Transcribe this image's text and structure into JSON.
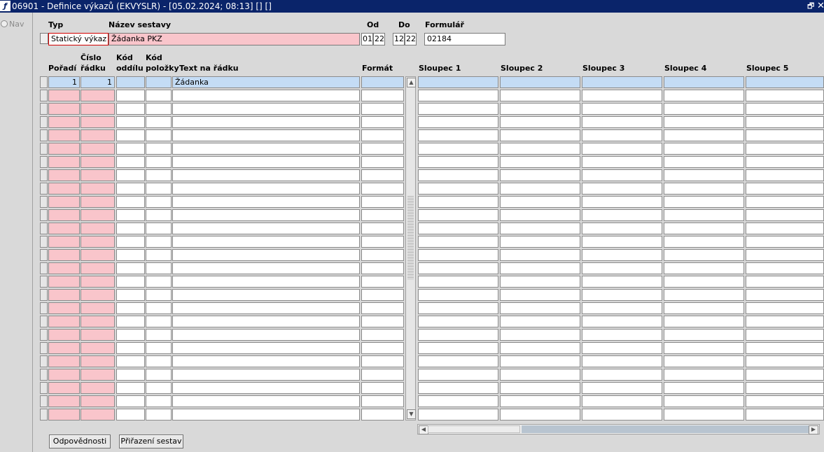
{
  "window": {
    "title": "06901 - Definice výkazů (EKVYSLR) - [05.02.2024; 08:13]  []  []",
    "app_icon": "ƒ"
  },
  "nav": {
    "label": "Nav"
  },
  "header": {
    "typ_label": "Typ",
    "nazev_label": "Název sestavy",
    "od_label": "Od",
    "do_label": "Do",
    "formular_label": "Formulář",
    "typ_value": "Statický výkaz",
    "nazev_value": "Žádanka PKZ",
    "od_month": "01",
    "od_year": "22",
    "do_month": "12",
    "do_year": "22",
    "formular_value": "02184"
  },
  "grid": {
    "col_poradi": "Pořadí",
    "col_cislo_1": "Číslo",
    "col_cislo_2": "řádku",
    "col_kod_oddilu_1": "Kód",
    "col_kod_oddilu_2": "oddílu",
    "col_kod_polozky_1": "Kód",
    "col_kod_polozky_2": "položky",
    "col_text": "Text na řádku",
    "col_format": "Formát",
    "col_sloupec_1": "Sloupec 1",
    "col_sloupec_2": "Sloupec 2",
    "col_sloupec_3": "Sloupec 3",
    "col_sloupec_4": "Sloupec 4",
    "col_sloupec_5": "Sloupec 5",
    "rows": [
      {
        "poradi": "1",
        "cislo": "1",
        "text": "Žádanka"
      }
    ],
    "empty_row_count": 25
  },
  "buttons": {
    "odpovednosti": "Odpovědnosti",
    "prirazeni": "Přiřazení sestav"
  },
  "colors": {
    "required_field": "#f9c5cb",
    "selected_row": "#c4dcf5",
    "title_bar": "#0a246a"
  }
}
